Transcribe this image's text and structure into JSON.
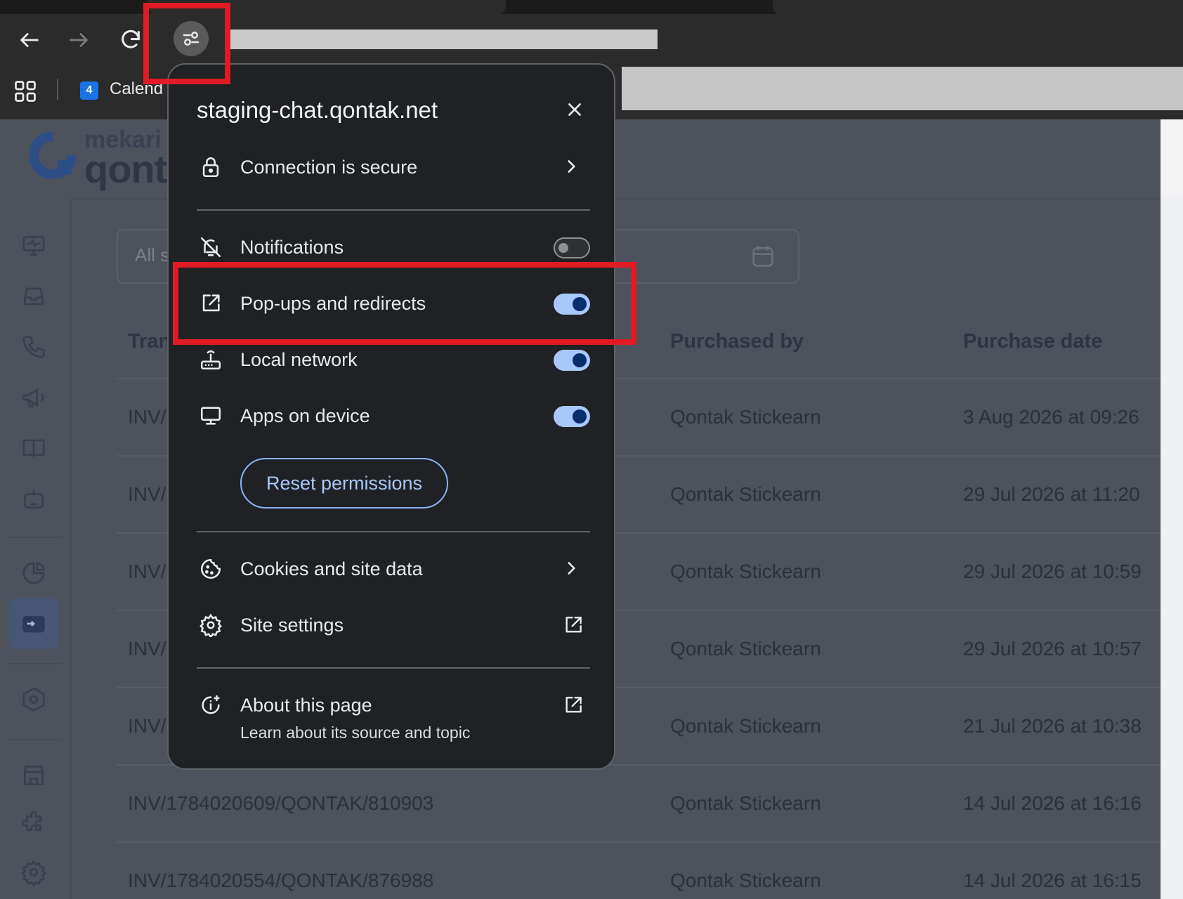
{
  "browser": {
    "bookmark_badge": "4",
    "bookmark_label": "Calend"
  },
  "app": {
    "logo_top": "mekari",
    "logo_main": "qonta",
    "filter_placeholder": "All s",
    "table": {
      "headers": [
        "Tran",
        "Purchased by",
        "Purchase date"
      ],
      "rows": [
        {
          "invoice": "INV/",
          "purchased_by": "Qontak Stickearn",
          "date": "3 Aug 2026 at 09:26"
        },
        {
          "invoice": "INV/",
          "purchased_by": "Qontak Stickearn",
          "date": "29 Jul 2026 at 11:20"
        },
        {
          "invoice": "INV/",
          "purchased_by": "Qontak Stickearn",
          "date": "29 Jul 2026 at 10:59"
        },
        {
          "invoice": "INV/",
          "purchased_by": "Qontak Stickearn",
          "date": "29 Jul 2026 at 10:57"
        },
        {
          "invoice": "INV/",
          "purchased_by": "Qontak Stickearn",
          "date": "21 Jul 2026 at 10:38"
        },
        {
          "invoice": "INV/1784020609/QONTAK/810903",
          "purchased_by": "Qontak Stickearn",
          "date": "14 Jul 2026 at 16:16"
        },
        {
          "invoice": "INV/1784020554/QONTAK/876988",
          "purchased_by": "Qontak Stickearn",
          "date": "14 Jul 2026 at 16:15"
        }
      ]
    }
  },
  "popup": {
    "title": "staging-chat.qontak.net",
    "connection": "Connection is secure",
    "notifications": {
      "label": "Notifications",
      "enabled": false
    },
    "popups": {
      "label": "Pop-ups and redirects",
      "enabled": true
    },
    "local_network": {
      "label": "Local network",
      "enabled": true
    },
    "apps_on_device": {
      "label": "Apps on device",
      "enabled": true
    },
    "reset_label": "Reset permissions",
    "cookies": "Cookies and site data",
    "site_settings": "Site settings",
    "about_title": "About this page",
    "about_subtitle": "Learn about its source and topic"
  },
  "colors": {
    "highlight": "#e01b24",
    "toggle_on": "#a8c7fa",
    "popup_bg": "#202124",
    "accent_blue": "#8ab4f8"
  }
}
